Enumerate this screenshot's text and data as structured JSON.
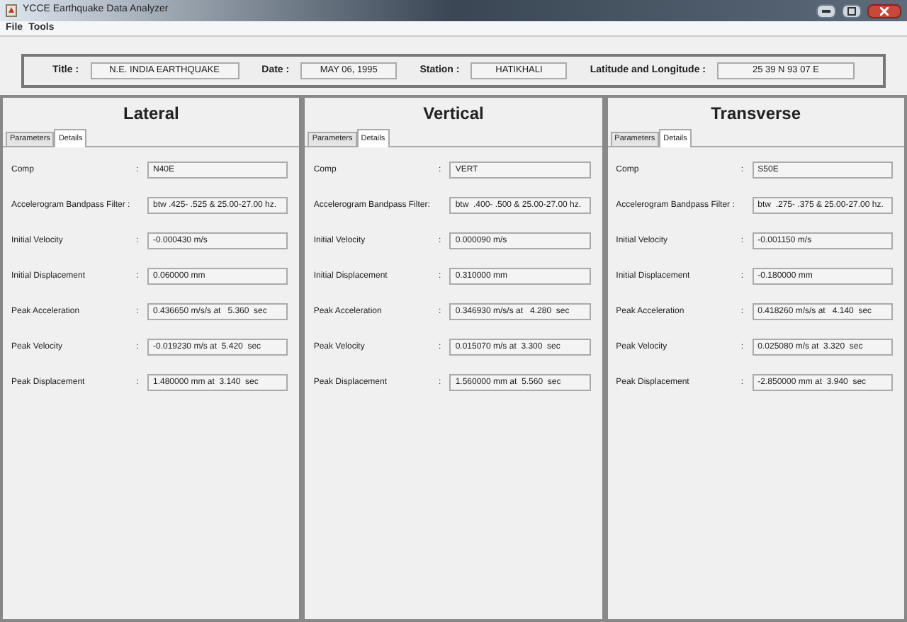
{
  "window": {
    "title": "YCCE Earthquake Data Analyzer"
  },
  "menu": [
    "File",
    "Tools"
  ],
  "header": [
    {
      "label": "Title :",
      "value": "N.E. INDIA EARTHQUAKE"
    },
    {
      "label": "Date :",
      "value": "MAY 06, 1995"
    },
    {
      "label": "Station :",
      "value": "HATIKHALI"
    },
    {
      "label": "Latitude and  Longitude :",
      "value": "25 39 N 93 07 E"
    }
  ],
  "panels": [
    {
      "title": "Lateral",
      "tabs": [
        {
          "label": "Parameters",
          "selected": false
        },
        {
          "label": "Details",
          "selected": true
        }
      ],
      "rows": [
        {
          "label": "Comp",
          "sep": ":",
          "value": "N40E"
        },
        {
          "label": "Accelerogram Bandpass Filter :",
          "value": "btw .425- .525 & 25.00-27.00 hz."
        },
        {
          "label": "Initial Velocity",
          "sep": ":",
          "value": "-0.000430 m/s"
        },
        {
          "label": "Initial Displacement",
          "sep": ":",
          "value": "0.060000 mm"
        },
        {
          "label": "Peak Acceleration",
          "sep": ":",
          "value": "0.436650 m/s/s at   5.360  sec"
        },
        {
          "label": "Peak Velocity",
          "sep": ":",
          "value": "-0.019230 m/s at  5.420  sec"
        },
        {
          "label": "Peak Displacement",
          "sep": ":",
          "value": "1.480000 mm at  3.140  sec"
        }
      ]
    },
    {
      "title": "Vertical",
      "tabs": [
        {
          "label": "Parameters",
          "selected": false
        },
        {
          "label": "Details",
          "selected": true
        }
      ],
      "rows": [
        {
          "label": "Comp",
          "sep": ":",
          "value": "VERT"
        },
        {
          "label": "Accelerogram Bandpass Filter:",
          "value": "btw  .400- .500 & 25.00-27.00 hz."
        },
        {
          "label": "Initial Velocity",
          "sep": ":",
          "value": "0.000090 m/s"
        },
        {
          "label": "Initial Displacement",
          "sep": ":",
          "value": "0.310000 mm"
        },
        {
          "label": "Peak Acceleration",
          "sep": ":",
          "value": "0.346930 m/s/s at   4.280  sec"
        },
        {
          "label": "Peak Velocity",
          "sep": ":",
          "value": "0.015070 m/s at  3.300  sec"
        },
        {
          "label": "Peak Displacement",
          "sep": ":",
          "value": "1.560000 mm at  5.560  sec"
        }
      ]
    },
    {
      "title": "Transverse",
      "tabs": [
        {
          "label": "Parameters",
          "selected": false
        },
        {
          "label": "Details",
          "selected": true
        }
      ],
      "rows": [
        {
          "label": "Comp",
          "sep": ":",
          "value": "S50E"
        },
        {
          "label": "Accelerogram Bandpass Filter :",
          "value": "btw  .275- .375 & 25.00-27.00 hz."
        },
        {
          "label": "Initial Velocity",
          "sep": ":",
          "value": "-0.001150 m/s"
        },
        {
          "label": "Initial Displacement",
          "sep": ":",
          "value": "-0.180000 mm"
        },
        {
          "label": "Peak Acceleration",
          "sep": ":",
          "value": "0.418260 m/s/s at   4.140  sec"
        },
        {
          "label": "Peak Velocity",
          "sep": ":",
          "value": "0.025080 m/s at  3.320  sec"
        },
        {
          "label": "Peak Displacement",
          "sep": ":",
          "value": "-2.850000 mm at  3.940  sec"
        }
      ]
    }
  ]
}
